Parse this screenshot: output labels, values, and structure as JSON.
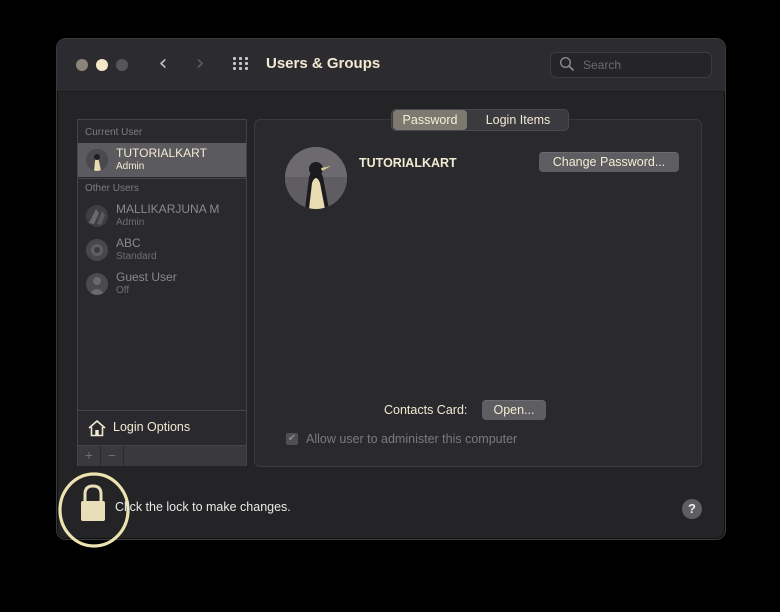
{
  "window": {
    "title": "Users & Groups",
    "search_placeholder": "Search"
  },
  "sidebar": {
    "current_header": "Current User",
    "other_header": "Other Users",
    "current_user": {
      "name": "TUTORIALKART",
      "role": "Admin"
    },
    "other_users": [
      {
        "name": "MALLIKARJUNA M",
        "role": "Admin"
      },
      {
        "name": "ABC",
        "role": "Standard"
      },
      {
        "name": "Guest User",
        "role": "Off"
      }
    ],
    "login_options_label": "Login Options",
    "add_label": "+",
    "remove_label": "−"
  },
  "tabs": [
    {
      "label": "Password",
      "selected": true
    },
    {
      "label": "Login Items",
      "selected": false
    }
  ],
  "detail": {
    "user_name": "TUTORIALKART",
    "change_password_label": "Change Password...",
    "contacts_card_label": "Contacts Card:",
    "open_label": "Open...",
    "allow_admin_label": "Allow user to administer this computer",
    "allow_admin_checked": true
  },
  "footer": {
    "lock_caption": "Click the lock to make changes.",
    "help_label": "?"
  },
  "colors": {
    "accent_cream": "#f1ead2",
    "lock_highlight": "#ece3b0",
    "window_bg": "#242326"
  },
  "icons": [
    "chevron-left-icon",
    "chevron-right-icon",
    "grid-icon",
    "search-icon",
    "house-icon",
    "lock-icon",
    "help-icon"
  ]
}
